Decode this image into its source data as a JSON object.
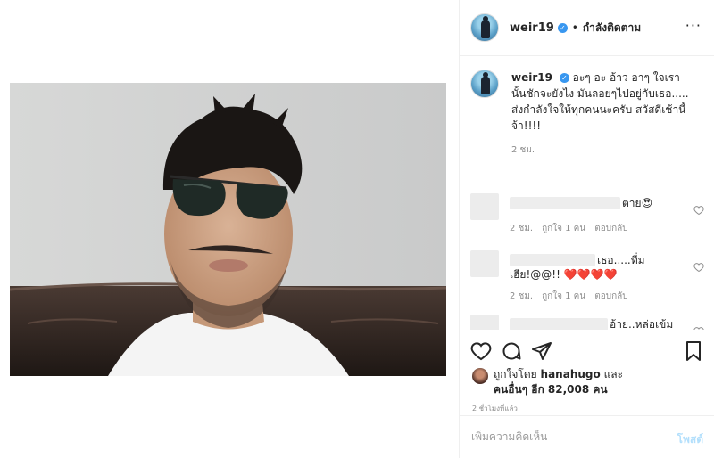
{
  "post": {
    "username": "weir19",
    "verified_icon": "verified-badge-icon",
    "follow_state": "กำลังติดตาม",
    "caption_user": "weir19",
    "caption_text": "อะๆ อะ อ้าว อาๆ ใจเรานั้นชักจะยังไง มันลอยๆไปอยู่กับเธอ..... ส่งกำลังใจให้ทุกคนนะครับ สวัสดีเช้านี้จ้า!!!!",
    "caption_time": "2 ชม."
  },
  "comments": [
    {
      "text": "ตาย😍",
      "time": "2 ชม.",
      "likes": "ถูกใจ 1 คน",
      "reply": "ตอบกลับ"
    },
    {
      "text_line1": "เธอ.....ที่ม",
      "text_line2": "เฮีย!@@!! ❤️❤️❤️❤️",
      "time": "2 ชม.",
      "likes": "ถูกใจ 1 คน",
      "reply": "ตอบกลับ"
    },
    {
      "text": "อ้าย..หล่อเข้ม"
    }
  ],
  "likes": {
    "prefix": "ถูกใจโดย",
    "user": "hanahugo",
    "and": "และ",
    "others": "คนอื่นๆ อีก 82,008 คน"
  },
  "post_time": "2 ชั่วโมงที่แล้ว",
  "add_comment": {
    "placeholder": "เพิ่มความคิดเห็น",
    "post_label": "โพสต์"
  },
  "colors": {
    "verified": "#3897f0",
    "like_heart": "#ed4956",
    "post_button": "#b2dffc"
  }
}
